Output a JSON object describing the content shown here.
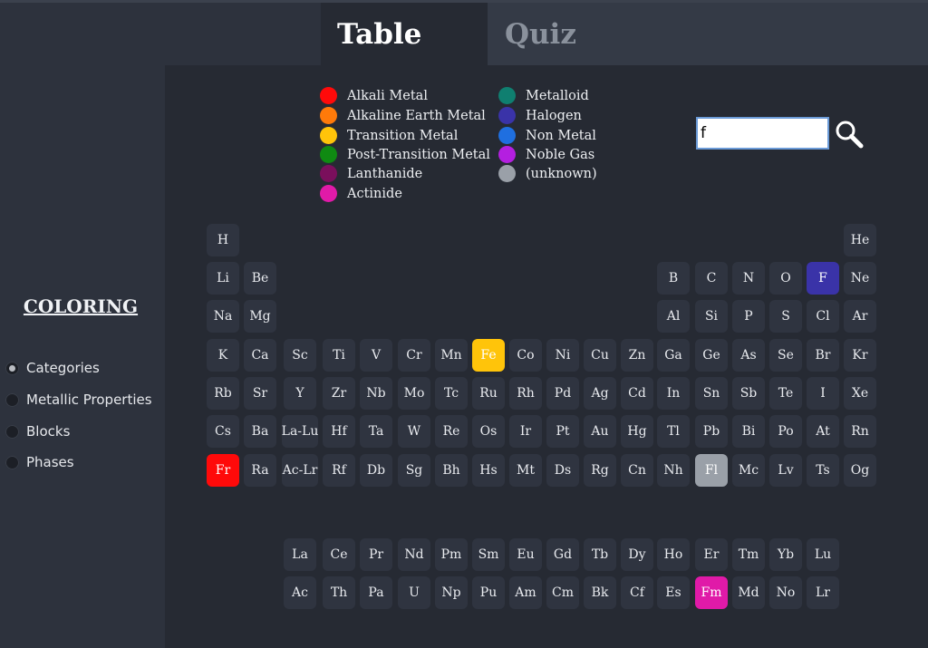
{
  "tabs": {
    "table": "Table",
    "quiz": "Quiz"
  },
  "coloring": {
    "title": "COLORING",
    "options": [
      "Categories",
      "Metallic Properties",
      "Blocks",
      "Phases"
    ],
    "selected": "Categories"
  },
  "legend": [
    {
      "label": "Alkali Metal",
      "color": "#ff0a0a"
    },
    {
      "label": "Alkaline Earth Metal",
      "color": "#ff7a0a"
    },
    {
      "label": "Transition Metal",
      "color": "#ffc40a"
    },
    {
      "label": "Post-Transition Metal",
      "color": "#0f8a12"
    },
    {
      "label": "Lanthanide",
      "color": "#7a0f5c"
    },
    {
      "label": "Actinide",
      "color": "#e01aa8"
    },
    {
      "label": "Metalloid",
      "color": "#0f7f70"
    },
    {
      "label": "Halogen",
      "color": "#3a33a8"
    },
    {
      "label": "Non Metal",
      "color": "#1f6fe0"
    },
    {
      "label": "Noble Gas",
      "color": "#b41fe0"
    },
    {
      "label": "(unknown)",
      "color": "#9aa0a8"
    }
  ],
  "search": {
    "value": "f",
    "icon": "magnifier-icon"
  },
  "elements": {
    "row1": [
      "H",
      "He"
    ],
    "row2": [
      "Li",
      "Be",
      "B",
      "C",
      "N",
      "O",
      "F",
      "Ne"
    ],
    "row3": [
      "Na",
      "Mg",
      "Al",
      "Si",
      "P",
      "S",
      "Cl",
      "Ar"
    ],
    "row4": [
      "K",
      "Ca",
      "Sc",
      "Ti",
      "V",
      "Cr",
      "Mn",
      "Fe",
      "Co",
      "Ni",
      "Cu",
      "Zn",
      "Ga",
      "Ge",
      "As",
      "Se",
      "Br",
      "Kr"
    ],
    "row5": [
      "Rb",
      "Sr",
      "Y",
      "Zr",
      "Nb",
      "Mo",
      "Tc",
      "Ru",
      "Rh",
      "Pd",
      "Ag",
      "Cd",
      "In",
      "Sn",
      "Sb",
      "Te",
      "I",
      "Xe"
    ],
    "row6": [
      "Cs",
      "Ba",
      "La-Lu",
      "Hf",
      "Ta",
      "W",
      "Re",
      "Os",
      "Ir",
      "Pt",
      "Au",
      "Hg",
      "Tl",
      "Pb",
      "Bi",
      "Po",
      "At",
      "Rn"
    ],
    "row7": [
      "Fr",
      "Ra",
      "Ac-Lr",
      "Rf",
      "Db",
      "Sg",
      "Bh",
      "Hs",
      "Mt",
      "Ds",
      "Rg",
      "Cn",
      "Nh",
      "Fl",
      "Mc",
      "Lv",
      "Ts",
      "Og"
    ],
    "lanthanides": [
      "La",
      "Ce",
      "Pr",
      "Nd",
      "Pm",
      "Sm",
      "Eu",
      "Gd",
      "Tb",
      "Dy",
      "Ho",
      "Er",
      "Tm",
      "Yb",
      "Lu"
    ],
    "actinides": [
      "Ac",
      "Th",
      "Pa",
      "U",
      "Np",
      "Pu",
      "Am",
      "Cm",
      "Bk",
      "Cf",
      "Es",
      "Fm",
      "Md",
      "No",
      "Lr"
    ]
  },
  "highlighted": {
    "F": "#3a33a8",
    "Fe": "#ffc40a",
    "Fr": "#ff0a0a",
    "Fl": "#9aa0a8",
    "Fm": "#e01aa8"
  }
}
